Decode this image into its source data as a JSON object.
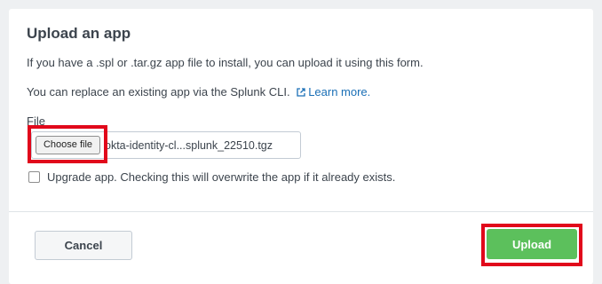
{
  "dialog": {
    "title": "Upload an app",
    "intro": "If you have a .spl or .tar.gz app file to install, you can upload it using this form.",
    "cli_text": "You can replace an existing app via the Splunk CLI.",
    "learn_more_label": "Learn more.",
    "file_label": "File",
    "choose_file_label": "Choose file",
    "selected_file_name": "okta-identity-cl...splunk_22510.tgz",
    "upgrade_label": "Upgrade app. Checking this will overwrite the app if it already exists.",
    "upgrade_checked": false
  },
  "footer": {
    "cancel_label": "Cancel",
    "upload_label": "Upload"
  },
  "colors": {
    "link": "#1a6fb6",
    "primary_button": "#5cc05c",
    "highlight": "#e1081b",
    "text": "#3c444d"
  },
  "icons": {
    "learn_more": "external-link-icon"
  }
}
